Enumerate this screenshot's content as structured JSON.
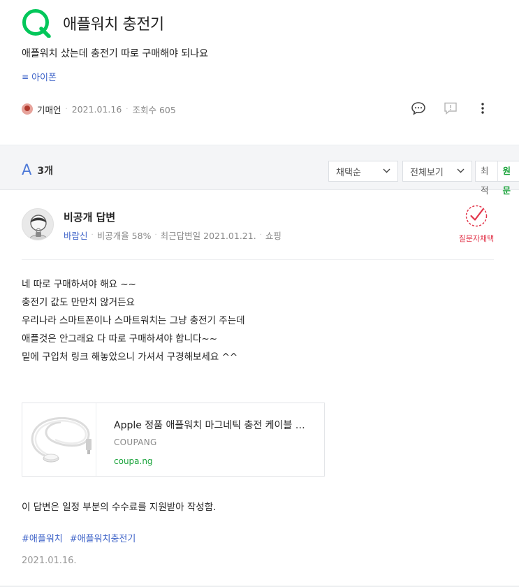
{
  "question": {
    "title": "애플워치 충전기",
    "body": "애플워치 샀는데 충전기 따로 구매해야 되나요",
    "category": "아이폰",
    "author": "기매언",
    "date": "2021.01.16",
    "views": "조회수 605"
  },
  "answers_header": {
    "count_label": "3개",
    "sort_select": "채택순",
    "filter_select": "전체보기",
    "seg_recent": "최적",
    "seg_original": "원문"
  },
  "answer": {
    "name": "비공개 답변",
    "username": "바람신",
    "private_rate": "비공개율 58%",
    "last_answer": "최근답변일 2021.01.21.",
    "category": "쇼핑",
    "adopt_label": "질문자채택",
    "body_lines": [
      "네 따로 구매하셔야 해요 ~~",
      "충전기 값도 만만치 않거든요",
      "우리나라 스마트폰이나 스마트워치는 그냥 충전기 주는데",
      "애플것은 안그래요 다 따로 구매하셔야 합니다~~",
      "밑에 구입처 링크 해놓았으니 가셔서 구경해보세요 ^^"
    ],
    "link_card": {
      "title": "Apple 정품 애플워치 마그네틱 충전 케이블 …",
      "source": "COUPANG",
      "url": "coupa.ng"
    },
    "disclaimer": "이 답변은 일정 부분의 수수료를 지원받아 작성함.",
    "tags": [
      "#애플워치",
      "#애플워치충전기"
    ],
    "date": "2021.01.16."
  },
  "colors": {
    "brand_green": "#03c75a",
    "link_blue": "#3e63c8",
    "adopt_red": "#e2364b"
  }
}
